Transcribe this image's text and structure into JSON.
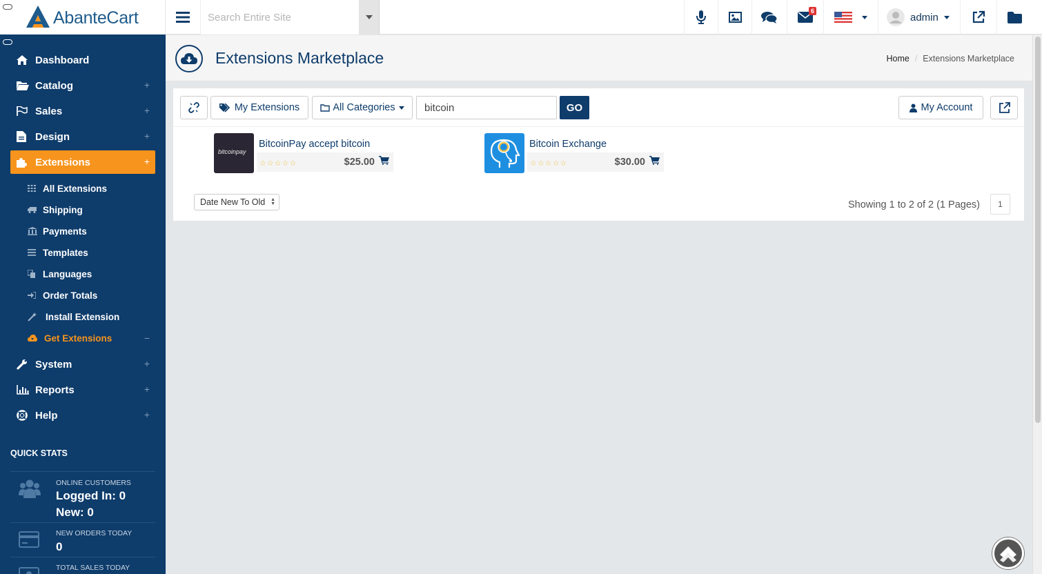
{
  "topbar": {
    "logo_text": "AbanteCart",
    "search_placeholder": "Search Entire Site",
    "mail_badge": "6",
    "user_name": "admin"
  },
  "sidebar": {
    "nav": [
      {
        "label": "Dashboard",
        "icon": "home-icon",
        "expand": ""
      },
      {
        "label": "Catalog",
        "icon": "folder-open-icon",
        "expand": "+"
      },
      {
        "label": "Sales",
        "icon": "flag-icon",
        "expand": "+"
      },
      {
        "label": "Design",
        "icon": "file-icon",
        "expand": "+"
      },
      {
        "label": "Extensions",
        "icon": "puzzle-icon",
        "expand": "+"
      },
      {
        "label": "System",
        "icon": "wrench-icon",
        "expand": "+"
      },
      {
        "label": "Reports",
        "icon": "bar-chart-icon",
        "expand": "+"
      },
      {
        "label": "Help",
        "icon": "lifebuoy-icon",
        "expand": "+"
      }
    ],
    "sub": [
      {
        "label": "All Extensions",
        "icon": "grid-icon"
      },
      {
        "label": "Shipping",
        "icon": "truck-icon"
      },
      {
        "label": "Payments",
        "icon": "bank-icon"
      },
      {
        "label": "Templates",
        "icon": "list-icon"
      },
      {
        "label": "Languages",
        "icon": "copy-icon"
      },
      {
        "label": "Order Totals",
        "icon": "sign-in-icon"
      },
      {
        "label": "Install Extension",
        "icon": "magic-icon"
      },
      {
        "label": "Get Extensions",
        "icon": "cloud-download-icon",
        "expand": "−"
      }
    ],
    "quick_stats": {
      "title": "QUICK STATS",
      "online_label": "ONLINE CUSTOMERS",
      "logged_in": "Logged In: 0",
      "new": "New: 0",
      "orders_label": "NEW ORDERS TODAY",
      "orders_value": "0",
      "sales_label": "TOTAL SALES TODAY"
    }
  },
  "header": {
    "title": "Extensions Marketplace",
    "breadcrumb_home": "Home",
    "breadcrumb_sep": "/",
    "breadcrumb_current": "Extensions Marketplace"
  },
  "toolbar": {
    "my_extensions": "My Extensions",
    "all_categories": "All Categories",
    "search_value": "bitcoin",
    "go": "GO",
    "my_account": "My Account"
  },
  "products": [
    {
      "name": "BitcoinPay accept bitcoin",
      "price": "$25.00",
      "rating": 0,
      "thumb_text": "bitcoinpay"
    },
    {
      "name": "Bitcoin Exchange",
      "price": "$30.00",
      "rating": 0
    }
  ],
  "footer": {
    "sort_value": "Date New To Old",
    "showing": "Showing 1 to 2 of 2 (1 Pages)",
    "page": "1"
  },
  "colors": {
    "primary": "#0e3c6b",
    "accent": "#f7941d",
    "background": "#e4e7ea"
  }
}
